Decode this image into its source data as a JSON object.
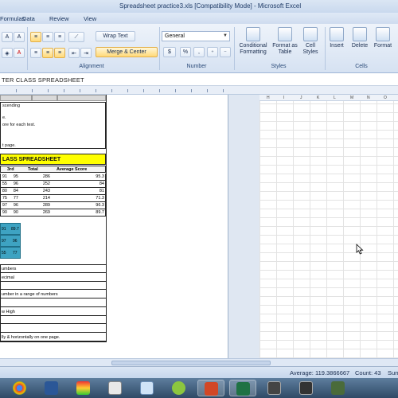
{
  "window": {
    "title": "Spreadsheet practice3.xls  [Compatibility Mode] - Microsoft Excel"
  },
  "tabs": [
    "Formulas",
    "Data",
    "Review",
    "View"
  ],
  "ribbon": {
    "wrap_text": "Wrap Text",
    "merge_center": "Merge & Center",
    "number_format": "General",
    "currency": "$",
    "percent": "%",
    "comma": ",",
    "increase_decimal": ".0→.00",
    "decrease_decimal": ".00→.0",
    "conditional_formatting": "Conditional Formatting",
    "format_as_table": "Format as Table",
    "cell_styles": "Cell Styles",
    "insert": "Insert",
    "delete": "Delete",
    "format": "Format",
    "group_alignment": "Alignment",
    "group_number": "Number",
    "group_styles": "Styles",
    "group_cells": "Cells"
  },
  "sheet": {
    "header_title": "TER CLASS SPREADSHEET",
    "instructions": [
      "scending",
      "e.",
      "ore for each test.",
      "t page."
    ],
    "yellow_title": "LASS SPREADSHEET",
    "table_header": {
      "c1": "3rd",
      "c2": "Total",
      "c3": "Average Score"
    },
    "rows": [
      {
        "a": "91",
        "b": "95",
        "c": "286",
        "d": "95.3"
      },
      {
        "a": "55",
        "b": "96",
        "c": "252",
        "d": "84"
      },
      {
        "a": "80",
        "b": "84",
        "c": "243",
        "d": "81"
      },
      {
        "a": "75",
        "b": "77",
        "c": "214",
        "d": "71.3"
      },
      {
        "a": "97",
        "b": "96",
        "c": "289",
        "d": "96.3"
      },
      {
        "a": "90",
        "b": "90",
        "c": "269",
        "d": "89.7"
      }
    ],
    "teal": [
      {
        "a": "91",
        "b": "89.7"
      },
      {
        "a": "97",
        "b": "96"
      },
      {
        "a": "55",
        "b": "77"
      }
    ],
    "lines": [
      "umbers",
      "ecimal",
      "",
      "umber in a range of numbers",
      "",
      "w High",
      "",
      "",
      "lly & horizontally on one page."
    ],
    "right_cols": [
      "H",
      "I",
      "J",
      "K",
      "L",
      "M",
      "N",
      "O"
    ]
  },
  "status": {
    "average": "Average: 119.3866667",
    "count": "Count: 43",
    "sum": "Sum"
  },
  "colors": {
    "yellow": "#ffff00",
    "teal": "#3ea3c2",
    "ribbon": "#dfe8f5"
  }
}
